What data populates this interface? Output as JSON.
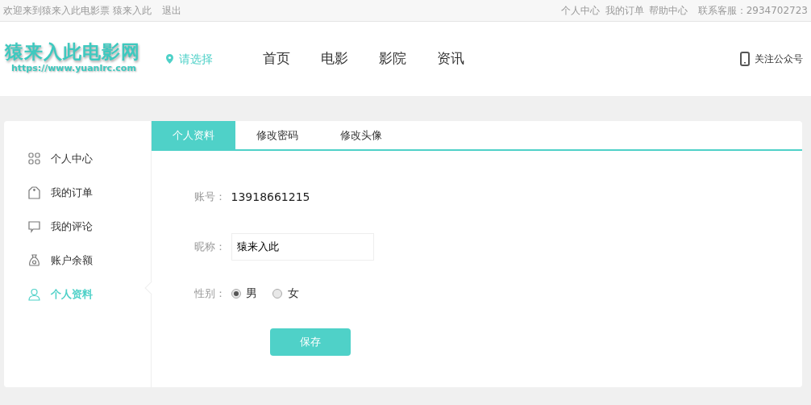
{
  "top_bar": {
    "welcome": "欢迎来到猿来入此电影票 猿来入此",
    "logout": "退出",
    "links": [
      "个人中心",
      "我的订单",
      "帮助中心"
    ],
    "service": "联系客服：2934702723"
  },
  "header": {
    "logo_title": "猿来入此电影网",
    "logo_url": "https://www.yuanlrc.com",
    "city": "请选择",
    "nav": [
      "首页",
      "电影",
      "影院",
      "资讯"
    ],
    "follow": "关注公众号"
  },
  "sidebar": {
    "items": [
      {
        "label": "个人中心",
        "kind": "grid",
        "selected": false
      },
      {
        "label": "我的订单",
        "kind": "tag",
        "selected": false
      },
      {
        "label": "我的评论",
        "kind": "comment",
        "selected": false
      },
      {
        "label": "账户余额",
        "kind": "bag",
        "selected": false
      },
      {
        "label": "个人资料",
        "kind": "person",
        "selected": true
      }
    ]
  },
  "tabs": [
    {
      "label": "个人资料",
      "selected": true
    },
    {
      "label": "修改密码",
      "selected": false
    },
    {
      "label": "修改头像",
      "selected": false
    }
  ],
  "form": {
    "account": {
      "label": "账号：",
      "value": "13918661215"
    },
    "nickname": {
      "label": "昵称：",
      "value": "猿来入此"
    },
    "gender": {
      "label": "性别：",
      "options": [
        {
          "label": "男",
          "selected": true
        },
        {
          "label": "女",
          "selected": false
        }
      ]
    },
    "save": "保存"
  }
}
